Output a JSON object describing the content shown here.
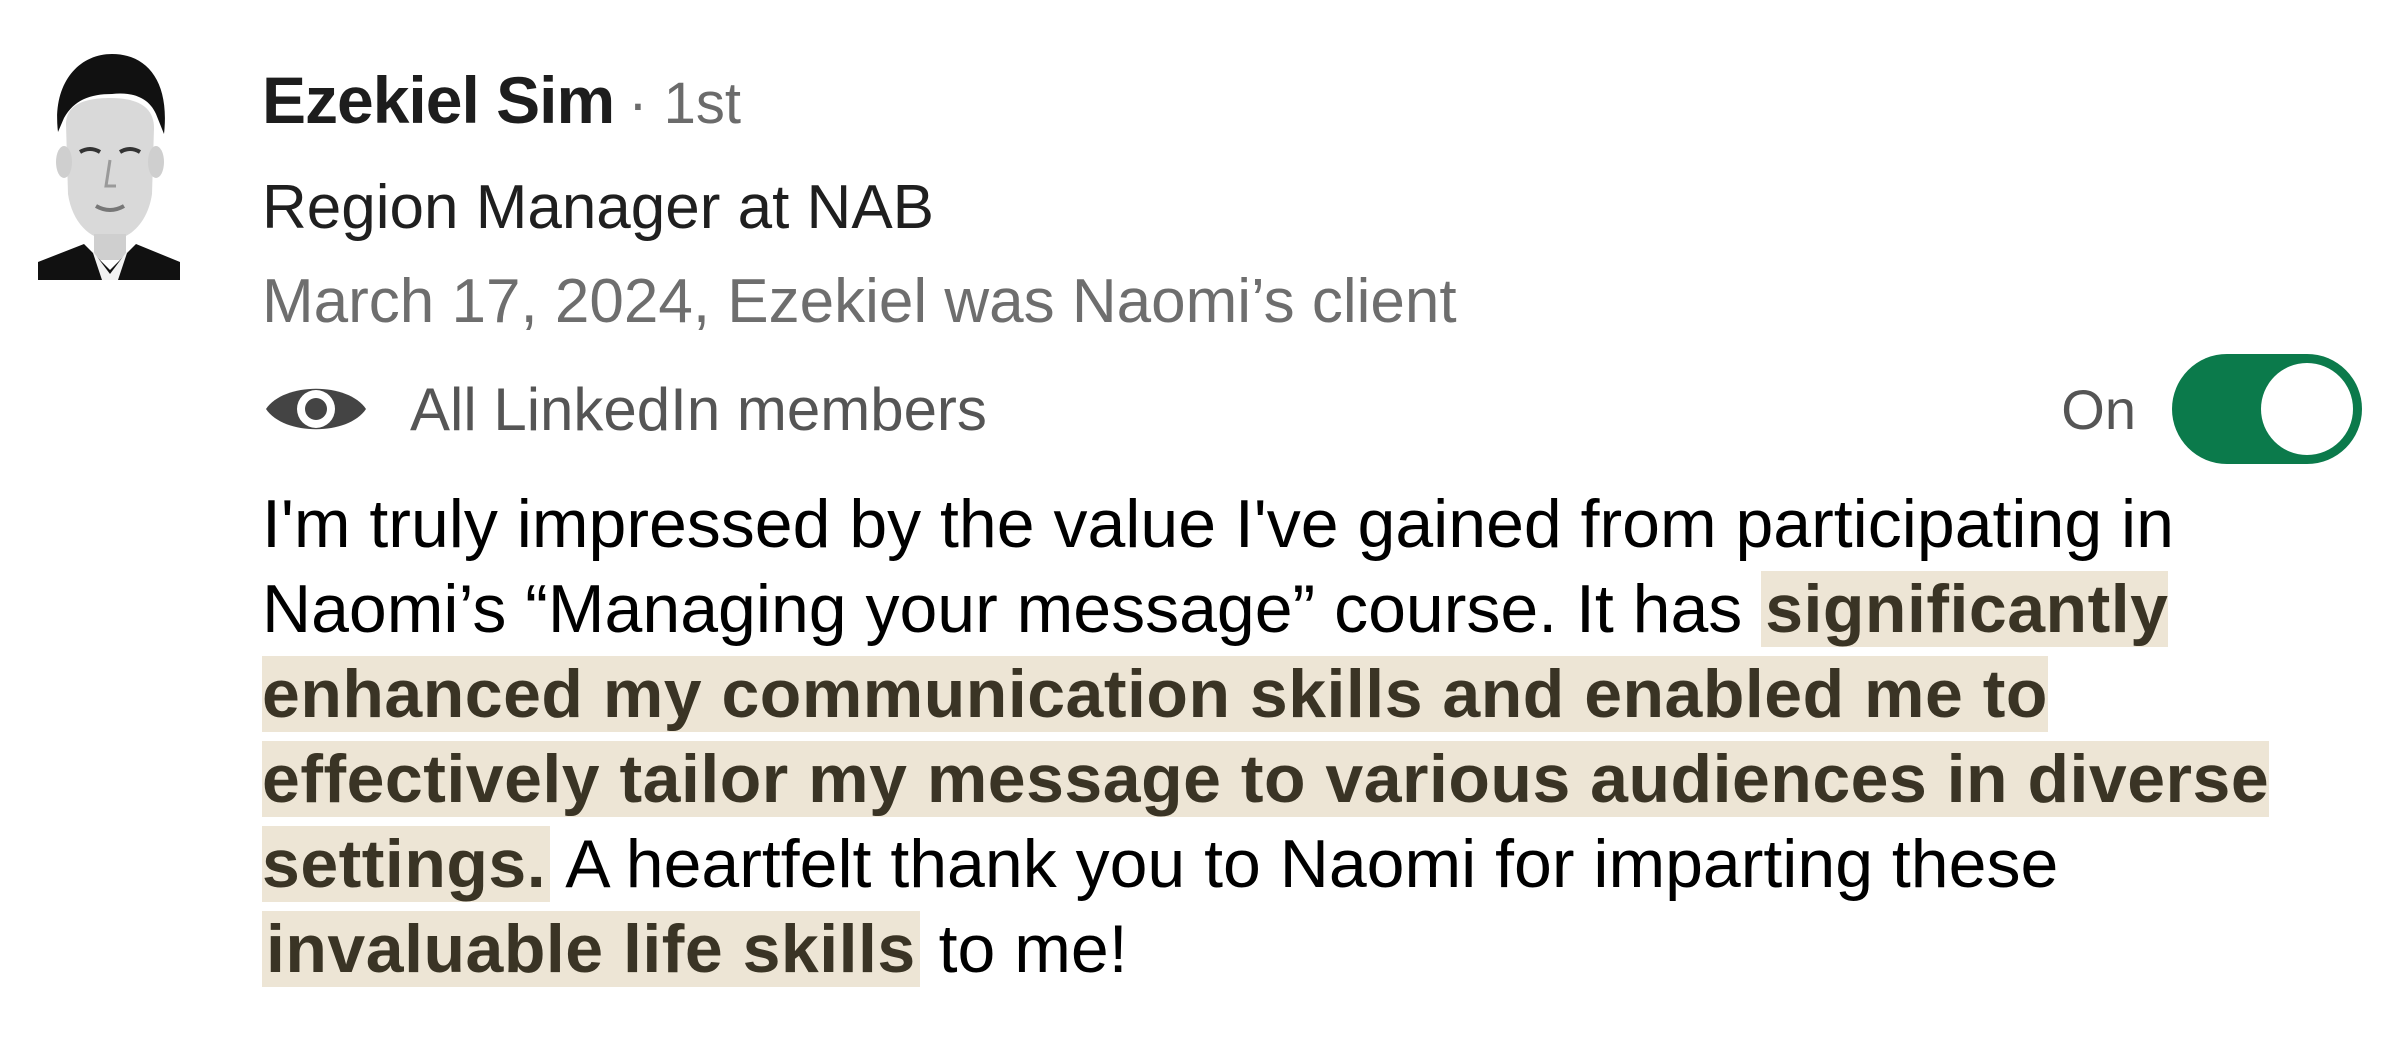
{
  "recommender": {
    "name": "Ezekiel Sim",
    "degree": "· 1st",
    "headline": "Region Manager at NAB",
    "meta": "March 17, 2024, Ezekiel was Naomi’s client"
  },
  "visibility": {
    "icon": "eye-icon",
    "label": "All LinkedIn members",
    "toggle_label": "On",
    "toggle_state": true,
    "toggle_color": "#0b7a4b"
  },
  "recommendation": {
    "p1": "I'm truly impressed by the value I've gained from participating in Naomi’s “Managing your message” course. It has ",
    "h1": "significantly enhanced my communication skills and enabled me to effectively tailor my message to various audiences in diverse settings.",
    "p2": " A heartfelt thank you to Naomi for imparting these ",
    "h2": "invaluable life skills",
    "p3": " to me!",
    "highlight_color": "#ede5d5"
  }
}
